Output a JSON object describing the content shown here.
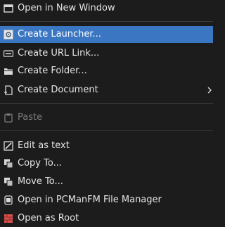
{
  "menu": {
    "items": [
      {
        "label": "Open in New Window",
        "icon": "window-icon"
      },
      {
        "label": "Create Launcher...",
        "icon": "gear-icon",
        "selected": true
      },
      {
        "label": "Create URL Link...",
        "icon": "link-icon"
      },
      {
        "label": "Create Folder...",
        "icon": "folder-icon"
      },
      {
        "label": "Create Document",
        "icon": "document-icon",
        "has_submenu": true
      },
      {
        "label": "Paste",
        "icon": "paste-icon",
        "disabled": true
      },
      {
        "label": "Edit as text",
        "icon": "edit-icon"
      },
      {
        "label": "Copy To...",
        "icon": "copy-icon"
      },
      {
        "label": "Move To...",
        "icon": "move-icon"
      },
      {
        "label": "Open in PCManFM File Manager",
        "icon": "file-manager-icon"
      },
      {
        "label": "Open as Root",
        "icon": "root-icon"
      }
    ]
  },
  "colors": {
    "background": "#1c1c1c",
    "highlight": "#3a76c2",
    "text": "#e4e4e4",
    "disabled_text": "#7a7a7a",
    "root_icon": "#d9534f"
  }
}
